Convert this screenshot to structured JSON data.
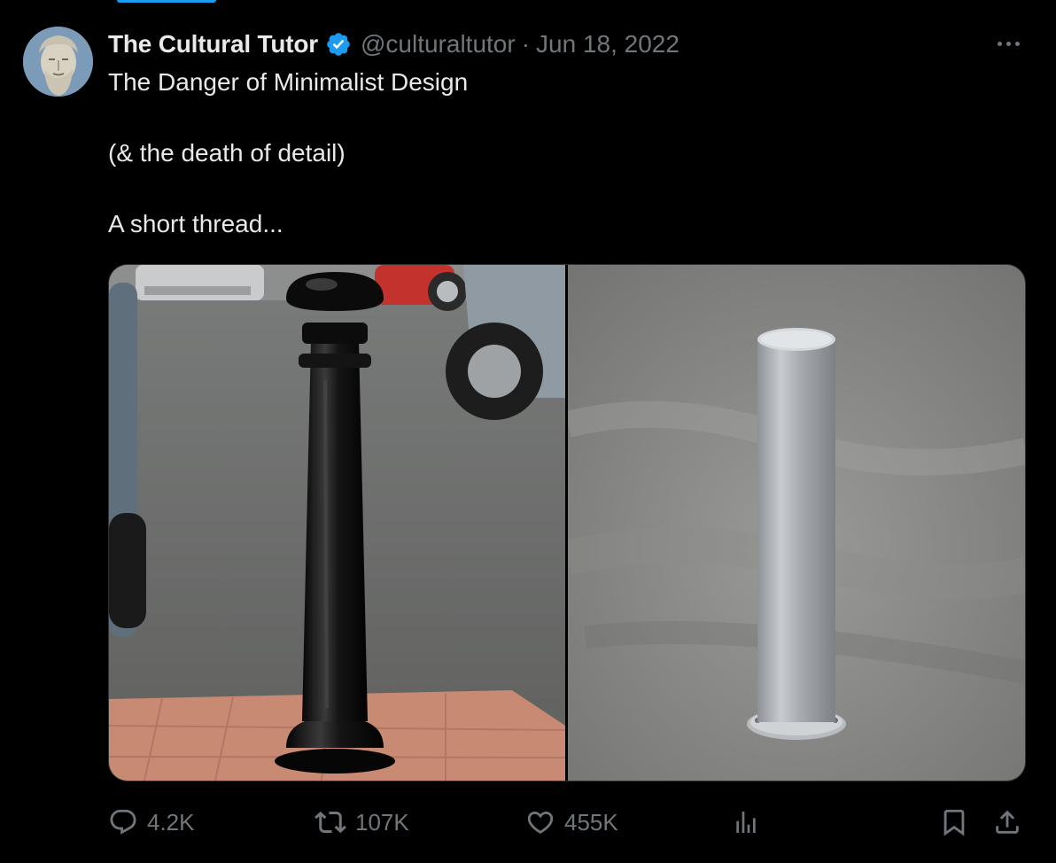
{
  "tweet": {
    "author_name": "The Cultural Tutor",
    "handle": "@culturaltutor",
    "separator": "·",
    "date": "Jun 18, 2022",
    "lines": [
      "The Danger of Minimalist Design",
      "(& the death of detail)",
      "A short thread..."
    ],
    "media": [
      {
        "icon": "ornate-black-bollard-photo"
      },
      {
        "icon": "steel-cylinder-bollard-photo"
      }
    ]
  },
  "actions": {
    "reply_count": "4.2K",
    "repost_count": "107K",
    "like_count": "455K"
  },
  "colors": {
    "background": "#000000",
    "text_primary": "#e7e9ea",
    "text_secondary": "#71767b",
    "accent": "#1d9bf0"
  }
}
